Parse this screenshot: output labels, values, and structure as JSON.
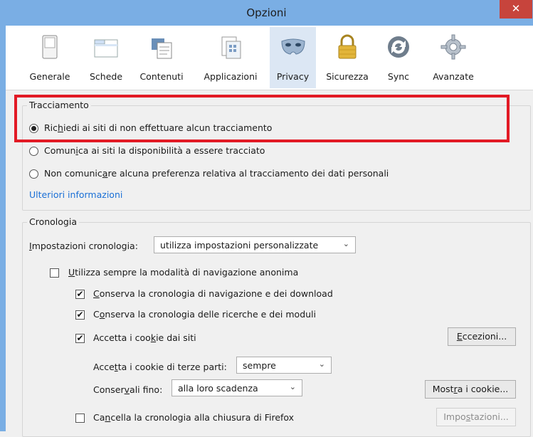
{
  "window": {
    "title": "Opzioni",
    "close_glyph": "✕"
  },
  "tabs": [
    {
      "label": "Generale",
      "icon": "switch-icon"
    },
    {
      "label": "Schede",
      "icon": "tabs-icon"
    },
    {
      "label": "Contenuti",
      "icon": "content-icon"
    },
    {
      "label": "Applicazioni",
      "icon": "applications-icon"
    },
    {
      "label": "Privacy",
      "icon": "mask-icon",
      "selected": true
    },
    {
      "label": "Sicurezza",
      "icon": "lock-icon"
    },
    {
      "label": "Sync",
      "icon": "sync-icon"
    },
    {
      "label": "Avanzate",
      "icon": "gear-icon"
    }
  ],
  "tracking": {
    "legend": "Tracciamento",
    "options": [
      {
        "pre": "Ric",
        "acc": "h",
        "post": "iedi ai siti di non effettuare alcun tracciamento",
        "selected": true
      },
      {
        "pre": "Comun",
        "acc": "i",
        "post": "ca ai siti la disponibilità a essere tracciato",
        "selected": false
      },
      {
        "pre": "Non comunic",
        "acc": "a",
        "post": "re alcuna preferenza relativa al tracciamento dei dati personali",
        "selected": false
      }
    ],
    "more_info": "Ulteriori informazioni"
  },
  "history": {
    "legend": "Cronologia",
    "settings_label": {
      "pre": "",
      "acc": "I",
      "post": "mpostazioni cronologia:"
    },
    "settings_value": "utilizza impostazioni personalizzate",
    "private_mode": {
      "pre": "",
      "acc": "U",
      "post": "tilizza sempre la modalità di navigazione anonima",
      "checked": false
    },
    "keep_history": {
      "pre": "",
      "acc": "C",
      "post": "onserva la cronologia di navigazione e dei download",
      "checked": true
    },
    "keep_search": {
      "pre": "C",
      "acc": "o",
      "post": "nserva la cronologia delle ricerche e dei moduli",
      "checked": true
    },
    "accept_cookies": {
      "pre": "Accetta i coo",
      "acc": "k",
      "post": "ie dai siti",
      "checked": true
    },
    "exceptions_button": {
      "pre": "",
      "acc": "E",
      "post": "ccezioni..."
    },
    "third_party_label": {
      "pre": "Acce",
      "acc": "t",
      "post": "ta i cookie di terze parti:"
    },
    "third_party_value": "sempre",
    "keep_until_label": {
      "pre": "Conser",
      "acc": "v",
      "post": "ali fino:"
    },
    "keep_until_value": "alla loro scadenza",
    "show_cookies_button": {
      "pre": "Most",
      "acc": "r",
      "post": "a i cookie..."
    },
    "clear_on_close": {
      "pre": "Ca",
      "acc": "n",
      "post": "cella la cronologia alla chiusura di Firefox",
      "checked": false
    },
    "settings_button": {
      "pre": "Impo",
      "acc": "s",
      "post": "tazioni..."
    }
  },
  "colors": {
    "frame": "#7aaee4",
    "close": "#c7443c",
    "selected_tab": "#dce7f4",
    "highlight": "#e21a25",
    "link": "#1a6fd6"
  }
}
